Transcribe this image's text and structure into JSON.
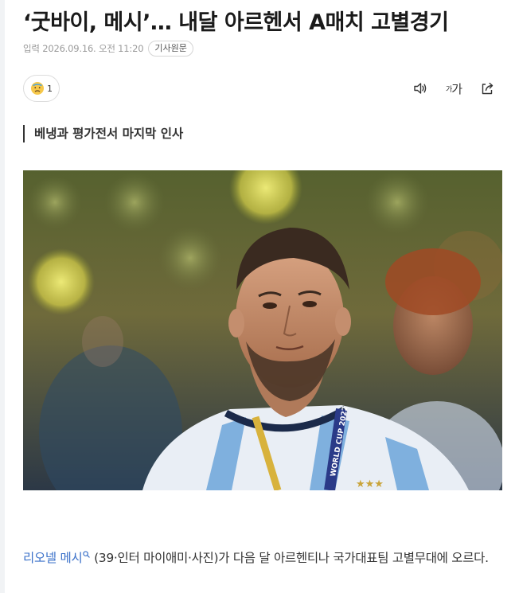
{
  "article": {
    "headline": "‘굿바이, 메시’… 내달 아르헨서 A매치 고별경기",
    "meta": {
      "published": "입력 2026.09.16. 오전 11:20",
      "original_link": "기사원문"
    },
    "reaction": {
      "icon": "sad-face-icon",
      "count": "1"
    },
    "tools": {
      "audio": "speaker-icon",
      "font_small": "가",
      "font_large": "가",
      "share": "share-icon"
    },
    "subtitle": "베냉과 평가전서 마지막 인사",
    "photo": {
      "icon": "photo-messi",
      "jersey_text": "WORLD CUP 2022"
    },
    "body": {
      "person_link": "리오넬 메시",
      "text_after": " (39·인터 마이애미·사진)가 다음 달 아르헨티나 국가대표팀 고별무대에 오르다."
    }
  },
  "colors": {
    "link": "#3b71c9",
    "headline": "#1a1a1a",
    "meta": "#9a9a9a"
  }
}
